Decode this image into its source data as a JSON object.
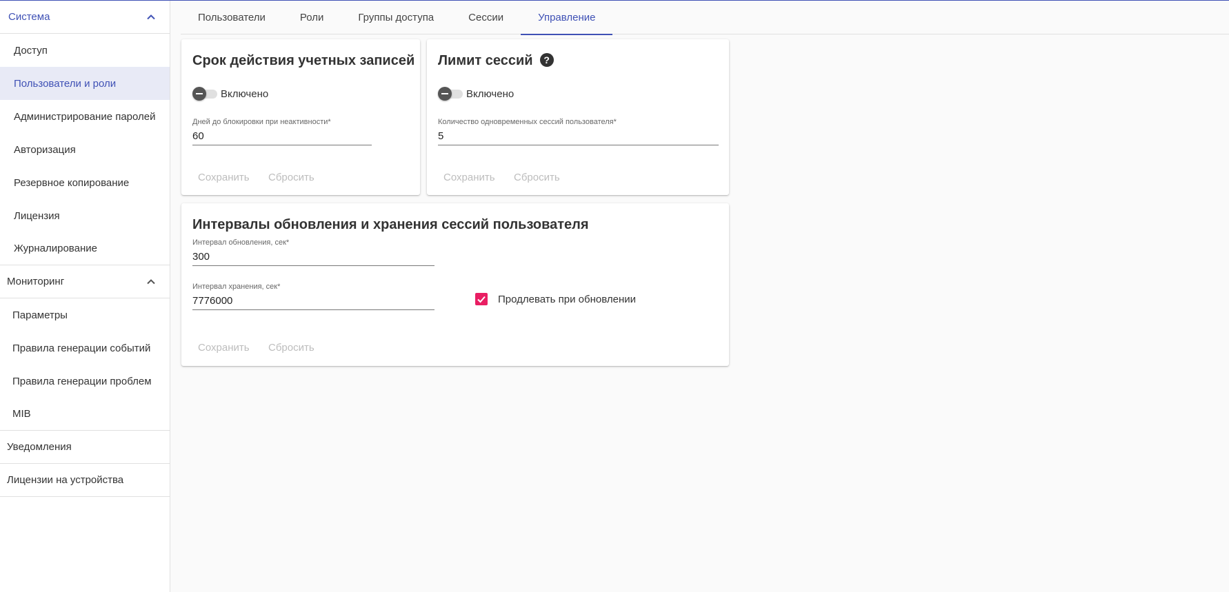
{
  "sidebar": {
    "groups": [
      {
        "title": "Система",
        "items": [
          "Доступ",
          "Пользователи и роли",
          "Администрирование паролей",
          "Авторизация",
          "Резервное копирование",
          "Лицензия",
          "Журналирование"
        ]
      },
      {
        "title": "Мониторинг",
        "items": [
          "Параметры",
          "Правила генерации событий",
          "Правила генерации проблем",
          "MIB"
        ]
      },
      {
        "title": "Уведомления"
      },
      {
        "title": "Лицензии на устройства"
      }
    ]
  },
  "tabs": [
    "Пользователи",
    "Роли",
    "Группы доступа",
    "Сессии",
    "Управление"
  ],
  "accountExpiry": {
    "title": "Срок действия учетных записей",
    "toggle_label": "Включено",
    "field_label": "Дней до блокировки при неактивности*",
    "field_value": "60",
    "save_label": "Сохранить",
    "reset_label": "Сбросить"
  },
  "sessionLimit": {
    "title": "Лимит сессий",
    "help_glyph": "?",
    "toggle_label": "Включено",
    "field_label": "Количество одновременных сессий пользователя*",
    "field_value": "5",
    "save_label": "Сохранить",
    "reset_label": "Сбросить"
  },
  "sessionIntervals": {
    "title": "Интервалы обновления и хранения сессий пользователя",
    "refresh_label": "Интервал обновления, сек*",
    "refresh_value": "300",
    "storage_label": "Интервал хранения, сек*",
    "storage_value": "7776000",
    "checkbox_label": "Продлевать при обновлении",
    "save_label": "Сохранить",
    "reset_label": "Сбросить"
  },
  "colors": {
    "accent": "#3f51b5",
    "checkbox": "#e91e63",
    "disabled_text": "#bdbdbd"
  }
}
